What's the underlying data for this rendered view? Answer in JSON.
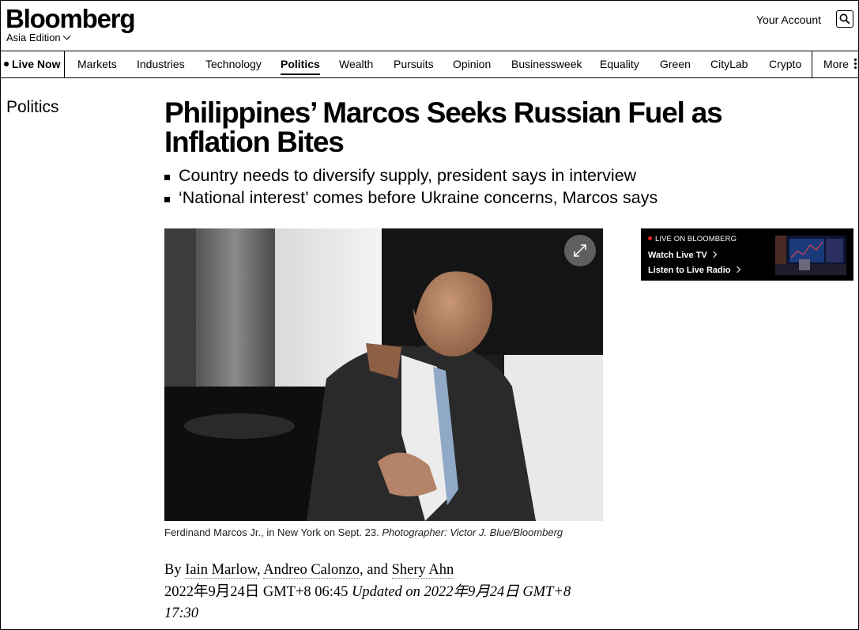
{
  "header": {
    "logo": "Bloomberg",
    "edition": "Asia Edition",
    "account": "Your Account",
    "search_icon": "search-icon"
  },
  "nav": {
    "live": "Live Now",
    "items": [
      {
        "label": "Markets"
      },
      {
        "label": "Industries"
      },
      {
        "label": "Technology"
      },
      {
        "label": "Politics",
        "active": true
      },
      {
        "label": "Wealth"
      },
      {
        "label": "Pursuits"
      },
      {
        "label": "Opinion"
      },
      {
        "label": "Businessweek"
      },
      {
        "label": "Equality"
      },
      {
        "label": "Green"
      },
      {
        "label": "CityLab"
      },
      {
        "label": "Crypto"
      }
    ],
    "more": "More"
  },
  "article": {
    "section": "Politics",
    "headline": "Philippines’ Marcos Seeks Russian Fuel as Inflation Bites",
    "bullets": [
      "Country needs to diversify supply, president says in interview",
      "‘National interest’ comes before Ukraine concerns, Marcos says"
    ],
    "caption": "Ferdinand Marcos Jr., in New York on Sept. 23.",
    "credit": "Photographer: Victor J. Blue/Bloomberg",
    "byline_prefix": "By",
    "authors": [
      "Iain Marlow",
      "Andreo Calonzo",
      "Shery Ahn"
    ],
    "published": "2022年9月24日 GMT+8 06:45",
    "updated": "Updated on 2022年9月24日 GMT+8 17:30"
  },
  "live_widget": {
    "label": "LIVE ON BLOOMBERG",
    "watch": "Watch Live TV",
    "listen": "Listen to Live Radio",
    "accent_color": "#e0241a"
  }
}
